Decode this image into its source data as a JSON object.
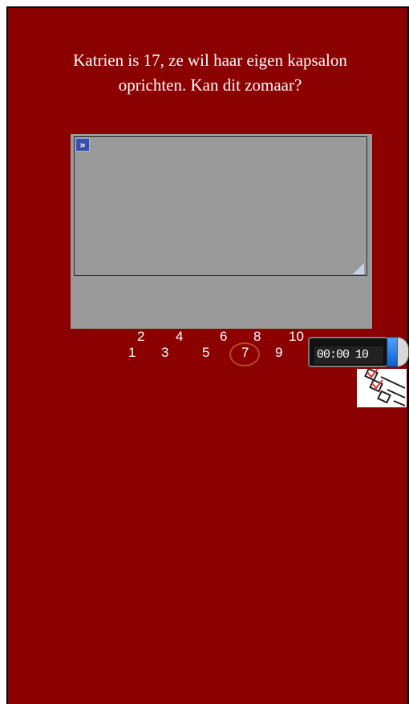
{
  "question": {
    "line1": "Katrien is 17, ze wil haar eigen kapsalon",
    "line2": "oprichten. Kan dit zomaar?"
  },
  "answer_box": {
    "expand_icon": "double-chevron-right-icon",
    "value": ""
  },
  "navigation": {
    "items": [
      "1",
      "2",
      "3",
      "4",
      "5",
      "6",
      "7",
      "8",
      "9",
      "10"
    ],
    "current": "7"
  },
  "timer": {
    "display": "00:00 10"
  },
  "colors": {
    "background": "#8b0000",
    "panel": "#9a9a9a",
    "current_ring": "#b84a1a"
  }
}
